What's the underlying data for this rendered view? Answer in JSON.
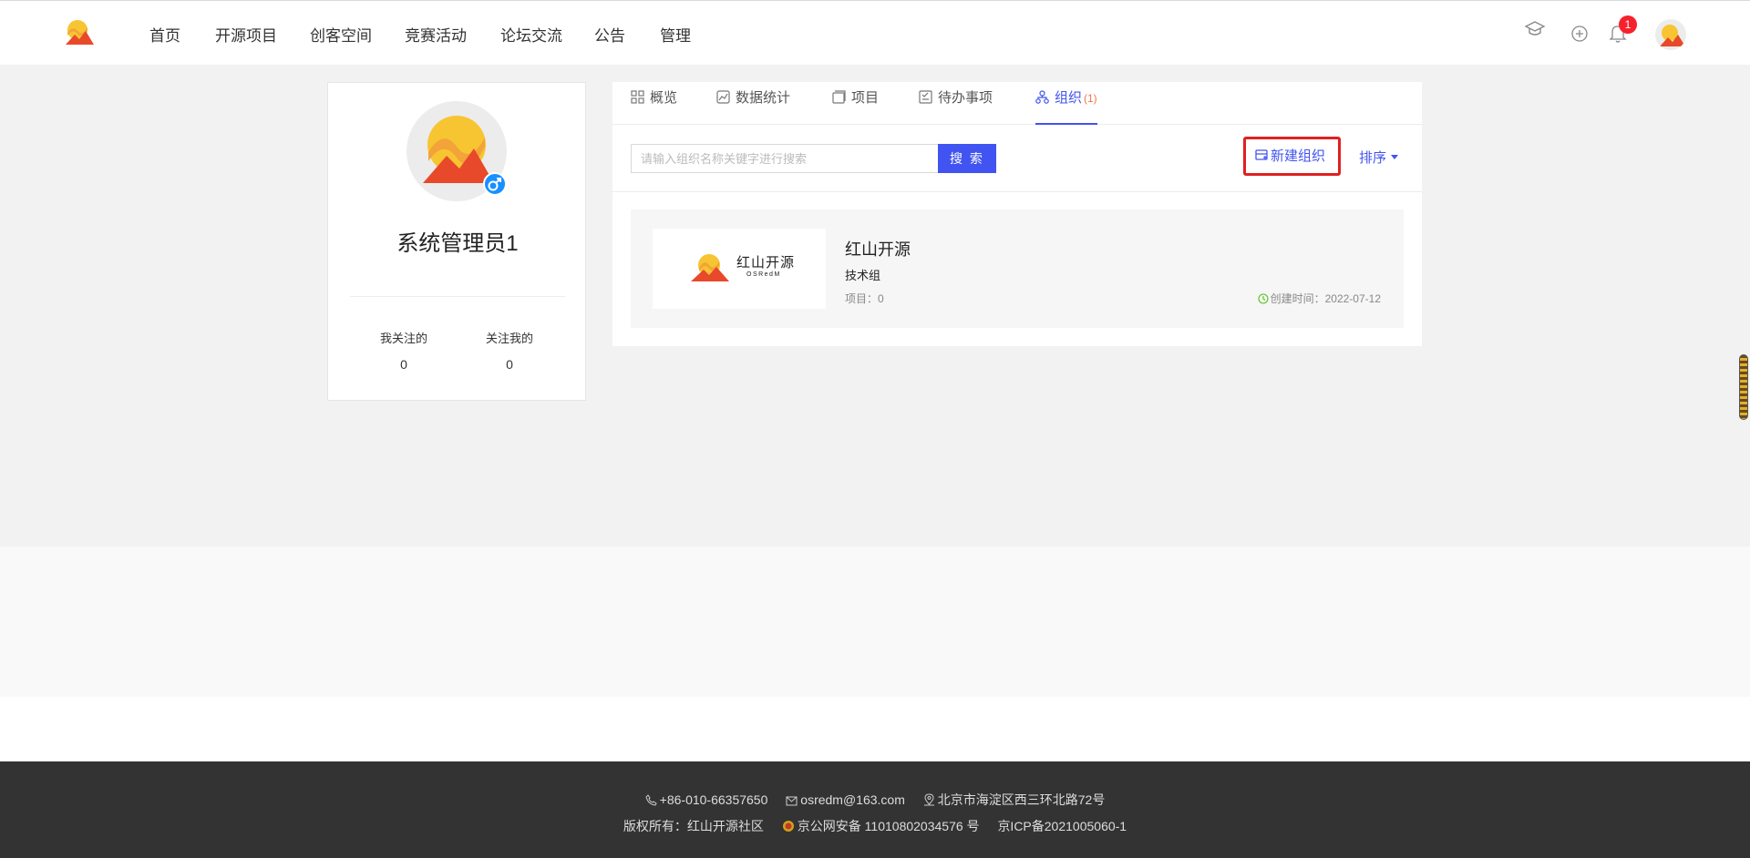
{
  "nav": {
    "items": [
      "首页",
      "开源项目",
      "创客空间",
      "竞赛活动",
      "论坛交流",
      "公告",
      "管理"
    ],
    "notification_count": "1"
  },
  "profile": {
    "name": "系统管理员1",
    "following_label": "我关注的",
    "following_count": "0",
    "followers_label": "关注我的",
    "followers_count": "0"
  },
  "tabs": [
    {
      "label": "概览",
      "icon": "grid-icon"
    },
    {
      "label": "数据统计",
      "icon": "chart-icon"
    },
    {
      "label": "项目",
      "icon": "project-icon"
    },
    {
      "label": "待办事项",
      "icon": "todo-icon"
    },
    {
      "label": "组织",
      "icon": "org-icon",
      "count": "(1)",
      "active": true
    }
  ],
  "toolbar": {
    "search_placeholder": "请输入组织名称关键字进行搜索",
    "search_label": "搜 索",
    "new_org_label": "新建组织",
    "sort_label": "排序"
  },
  "org": {
    "logo_text": "红山开源",
    "logo_subtext": "OSRedM",
    "name": "红山开源",
    "group": "技术组",
    "projects": "项目：0",
    "created": "创建时间：2022-07-12"
  },
  "footer": {
    "phone": "+86-010-66357650",
    "email": "osredm@163.com",
    "address": "北京市海淀区西三环北路72号",
    "copyright": "版权所有：红山开源社区",
    "police": "京公网安备 11010802034576 号",
    "icp": "京ICP备2021005060-1"
  },
  "colors": {
    "accent": "#4154f1",
    "highlight_border": "#e02020",
    "footer_bg": "#333333"
  }
}
